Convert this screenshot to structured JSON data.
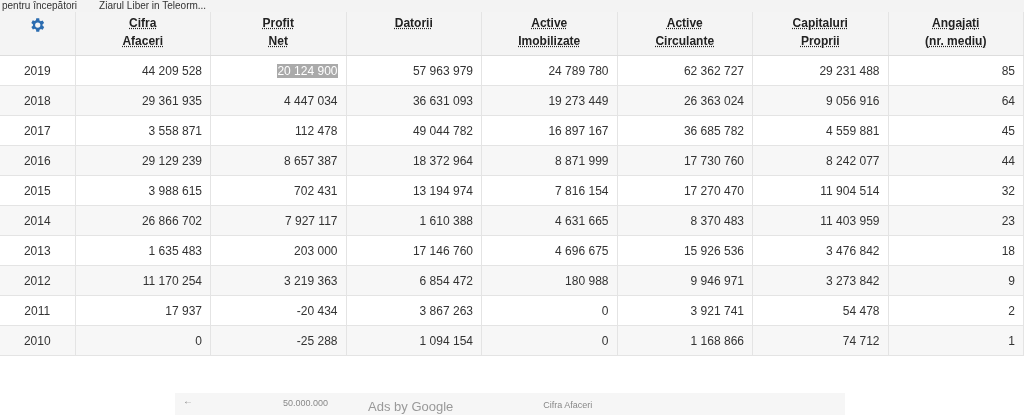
{
  "bookmarks_bar": {
    "items": [
      {
        "label": "pentru începători"
      },
      {
        "label": "Ziarul Liber in Teleorm..."
      }
    ]
  },
  "table": {
    "columns": [
      {
        "lines": [
          "Cifra",
          "Afaceri"
        ]
      },
      {
        "lines": [
          "Profit",
          "Net"
        ]
      },
      {
        "lines": [
          "Datorii"
        ]
      },
      {
        "lines": [
          "Active",
          "Imobilizate"
        ]
      },
      {
        "lines": [
          "Active",
          "Circulante"
        ]
      },
      {
        "lines": [
          "Capitaluri",
          "Proprii"
        ]
      },
      {
        "lines": [
          "Angajați",
          "(nr. mediu)"
        ]
      }
    ],
    "rows": [
      {
        "year": "2019",
        "cells": [
          {
            "value": "44 209 528",
            "selected": false
          },
          {
            "value": "20 124 900",
            "selected": true
          },
          {
            "value": "57 963 979",
            "selected": false
          },
          {
            "value": "24 789 780",
            "selected": false
          },
          {
            "value": "62 362 727",
            "selected": false
          },
          {
            "value": "29 231 488",
            "selected": false
          },
          {
            "value": "85",
            "selected": false
          }
        ]
      },
      {
        "year": "2018",
        "cells": [
          {
            "value": "29 361 935",
            "selected": false
          },
          {
            "value": "4 447 034",
            "selected": false
          },
          {
            "value": "36 631 093",
            "selected": false
          },
          {
            "value": "19 273 449",
            "selected": false
          },
          {
            "value": "26 363 024",
            "selected": false
          },
          {
            "value": "9 056 916",
            "selected": false
          },
          {
            "value": "64",
            "selected": false
          }
        ]
      },
      {
        "year": "2017",
        "cells": [
          {
            "value": "3 558 871",
            "selected": false
          },
          {
            "value": "112 478",
            "selected": false
          },
          {
            "value": "49 044 782",
            "selected": false
          },
          {
            "value": "16 897 167",
            "selected": false
          },
          {
            "value": "36 685 782",
            "selected": false
          },
          {
            "value": "4 559 881",
            "selected": false
          },
          {
            "value": "45",
            "selected": false
          }
        ]
      },
      {
        "year": "2016",
        "cells": [
          {
            "value": "29 129 239",
            "selected": false
          },
          {
            "value": "8 657 387",
            "selected": false
          },
          {
            "value": "18 372 964",
            "selected": false
          },
          {
            "value": "8 871 999",
            "selected": false
          },
          {
            "value": "17 730 760",
            "selected": false
          },
          {
            "value": "8 242 077",
            "selected": false
          },
          {
            "value": "44",
            "selected": false
          }
        ]
      },
      {
        "year": "2015",
        "cells": [
          {
            "value": "3 988 615",
            "selected": false
          },
          {
            "value": "702 431",
            "selected": false
          },
          {
            "value": "13 194 974",
            "selected": false
          },
          {
            "value": "7 816 154",
            "selected": false
          },
          {
            "value": "17 270 470",
            "selected": false
          },
          {
            "value": "11 904 514",
            "selected": false
          },
          {
            "value": "32",
            "selected": false
          }
        ]
      },
      {
        "year": "2014",
        "cells": [
          {
            "value": "26 866 702",
            "selected": false
          },
          {
            "value": "7 927 117",
            "selected": false
          },
          {
            "value": "1 610 388",
            "selected": false
          },
          {
            "value": "4 631 665",
            "selected": false
          },
          {
            "value": "8 370 483",
            "selected": false
          },
          {
            "value": "11 403 959",
            "selected": false
          },
          {
            "value": "23",
            "selected": false
          }
        ]
      },
      {
        "year": "2013",
        "cells": [
          {
            "value": "1 635 483",
            "selected": false
          },
          {
            "value": "203 000",
            "selected": false
          },
          {
            "value": "17 146 760",
            "selected": false
          },
          {
            "value": "4 696 675",
            "selected": false
          },
          {
            "value": "15 926 536",
            "selected": false
          },
          {
            "value": "3 476 842",
            "selected": false
          },
          {
            "value": "18",
            "selected": false
          }
        ]
      },
      {
        "year": "2012",
        "cells": [
          {
            "value": "11 170 254",
            "selected": false
          },
          {
            "value": "3 219 363",
            "selected": false
          },
          {
            "value": "6 854 472",
            "selected": false
          },
          {
            "value": "180 988",
            "selected": false
          },
          {
            "value": "9 946 971",
            "selected": false
          },
          {
            "value": "3 273 842",
            "selected": false
          },
          {
            "value": "9",
            "selected": false
          }
        ]
      },
      {
        "year": "2011",
        "cells": [
          {
            "value": "17 937",
            "selected": false
          },
          {
            "value": "-20 434",
            "selected": false
          },
          {
            "value": "3 867 263",
            "selected": false
          },
          {
            "value": "0",
            "selected": false
          },
          {
            "value": "3 921 741",
            "selected": false
          },
          {
            "value": "54 478",
            "selected": false
          },
          {
            "value": "2",
            "selected": false
          }
        ]
      },
      {
        "year": "2010",
        "cells": [
          {
            "value": "0",
            "selected": false
          },
          {
            "value": "-25 288",
            "selected": false
          },
          {
            "value": "1 094 154",
            "selected": false
          },
          {
            "value": "0",
            "selected": false
          },
          {
            "value": "1 168 866",
            "selected": false
          },
          {
            "value": "74 712",
            "selected": false
          },
          {
            "value": "1",
            "selected": false
          }
        ]
      }
    ]
  },
  "ad": {
    "back": "←",
    "axis_label": "50.000.000",
    "title": "Ads by Google",
    "legend": "Cifra Afaceri"
  }
}
